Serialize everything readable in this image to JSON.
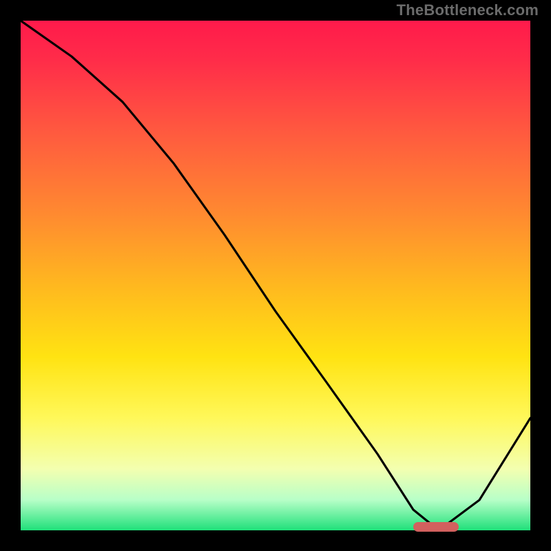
{
  "watermark": "TheBottleneck.com",
  "colors": {
    "frame": "#000000",
    "marker": "#d2605e",
    "curve": "#000000",
    "gradient_stops": [
      "#ff1a4b",
      "#ff2d49",
      "#ff5a3f",
      "#ff8a30",
      "#ffb81f",
      "#ffe312",
      "#fff85a",
      "#f3ffb0",
      "#b8ffc8",
      "#1fe07a"
    ]
  },
  "chart_data": {
    "type": "line",
    "title": "",
    "xlabel": "",
    "ylabel": "",
    "xlim": [
      0,
      100
    ],
    "ylim": [
      0,
      100
    ],
    "x": [
      0,
      10,
      20,
      30,
      40,
      50,
      60,
      70,
      77,
      82,
      90,
      100
    ],
    "values": [
      100,
      93,
      84,
      72,
      58,
      43,
      29,
      15,
      4,
      0,
      6,
      22
    ],
    "notes": "y is approximate relative height of the black curve read off the gradient; 100=top of plot, 0=bottom",
    "marker": {
      "x_start": 77,
      "x_end": 86,
      "y": 0.5
    }
  }
}
